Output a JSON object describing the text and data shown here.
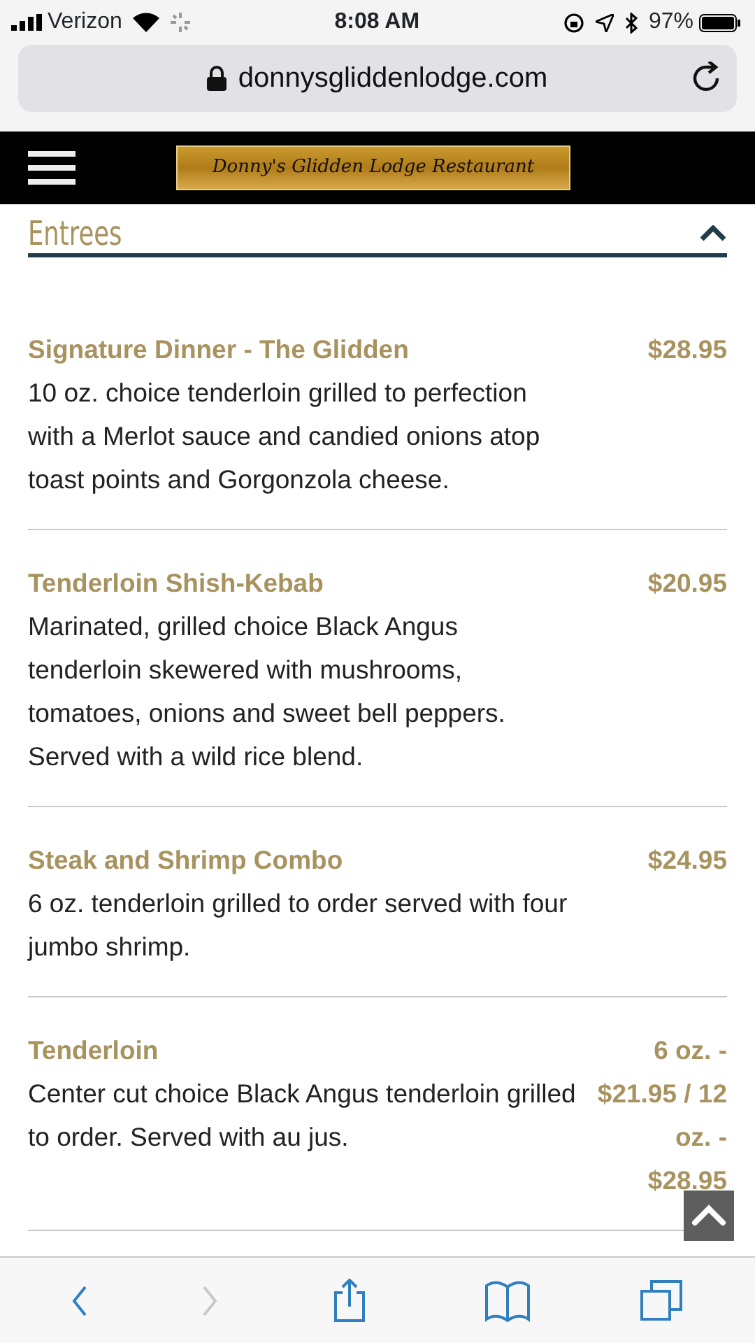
{
  "status_bar": {
    "carrier": "Verizon",
    "time": "8:08 AM",
    "battery": "97%"
  },
  "address_bar": {
    "url": "donnysgliddenlodge.com"
  },
  "site_header": {
    "logo_text": "Donny's Glidden Lodge Restaurant"
  },
  "section": {
    "title": "Entrees",
    "expanded": true
  },
  "menu_items": [
    {
      "name": "Signature Dinner - The Glidden",
      "price": "$28.95",
      "description": "10 oz. choice tenderloin grilled to perfection with a Merlot sauce and candied onions atop toast points and Gorgonzola cheese."
    },
    {
      "name": "Tenderloin Shish-Kebab",
      "price": "$20.95",
      "description": "Marinated, grilled choice Black Angus tenderloin skewered with mushrooms, tomatoes, onions and sweet bell peppers. Served with a wild rice blend."
    },
    {
      "name": "Steak and Shrimp Combo",
      "price": "$24.95",
      "description": "6 oz. tenderloin grilled to order served with four jumbo shrimp."
    },
    {
      "name": "Tenderloin",
      "price": "6 oz. - $21.95 / 12 oz. - $28.95",
      "description": "Center cut choice Black Angus tenderloin grilled to order. Served with au jus."
    }
  ],
  "toolbar": [
    {
      "kind": "back",
      "disabled": false
    },
    {
      "kind": "forward",
      "disabled": true
    },
    {
      "kind": "share",
      "disabled": false
    },
    {
      "kind": "bookmarks",
      "disabled": false
    },
    {
      "kind": "tabs",
      "disabled": false
    }
  ]
}
